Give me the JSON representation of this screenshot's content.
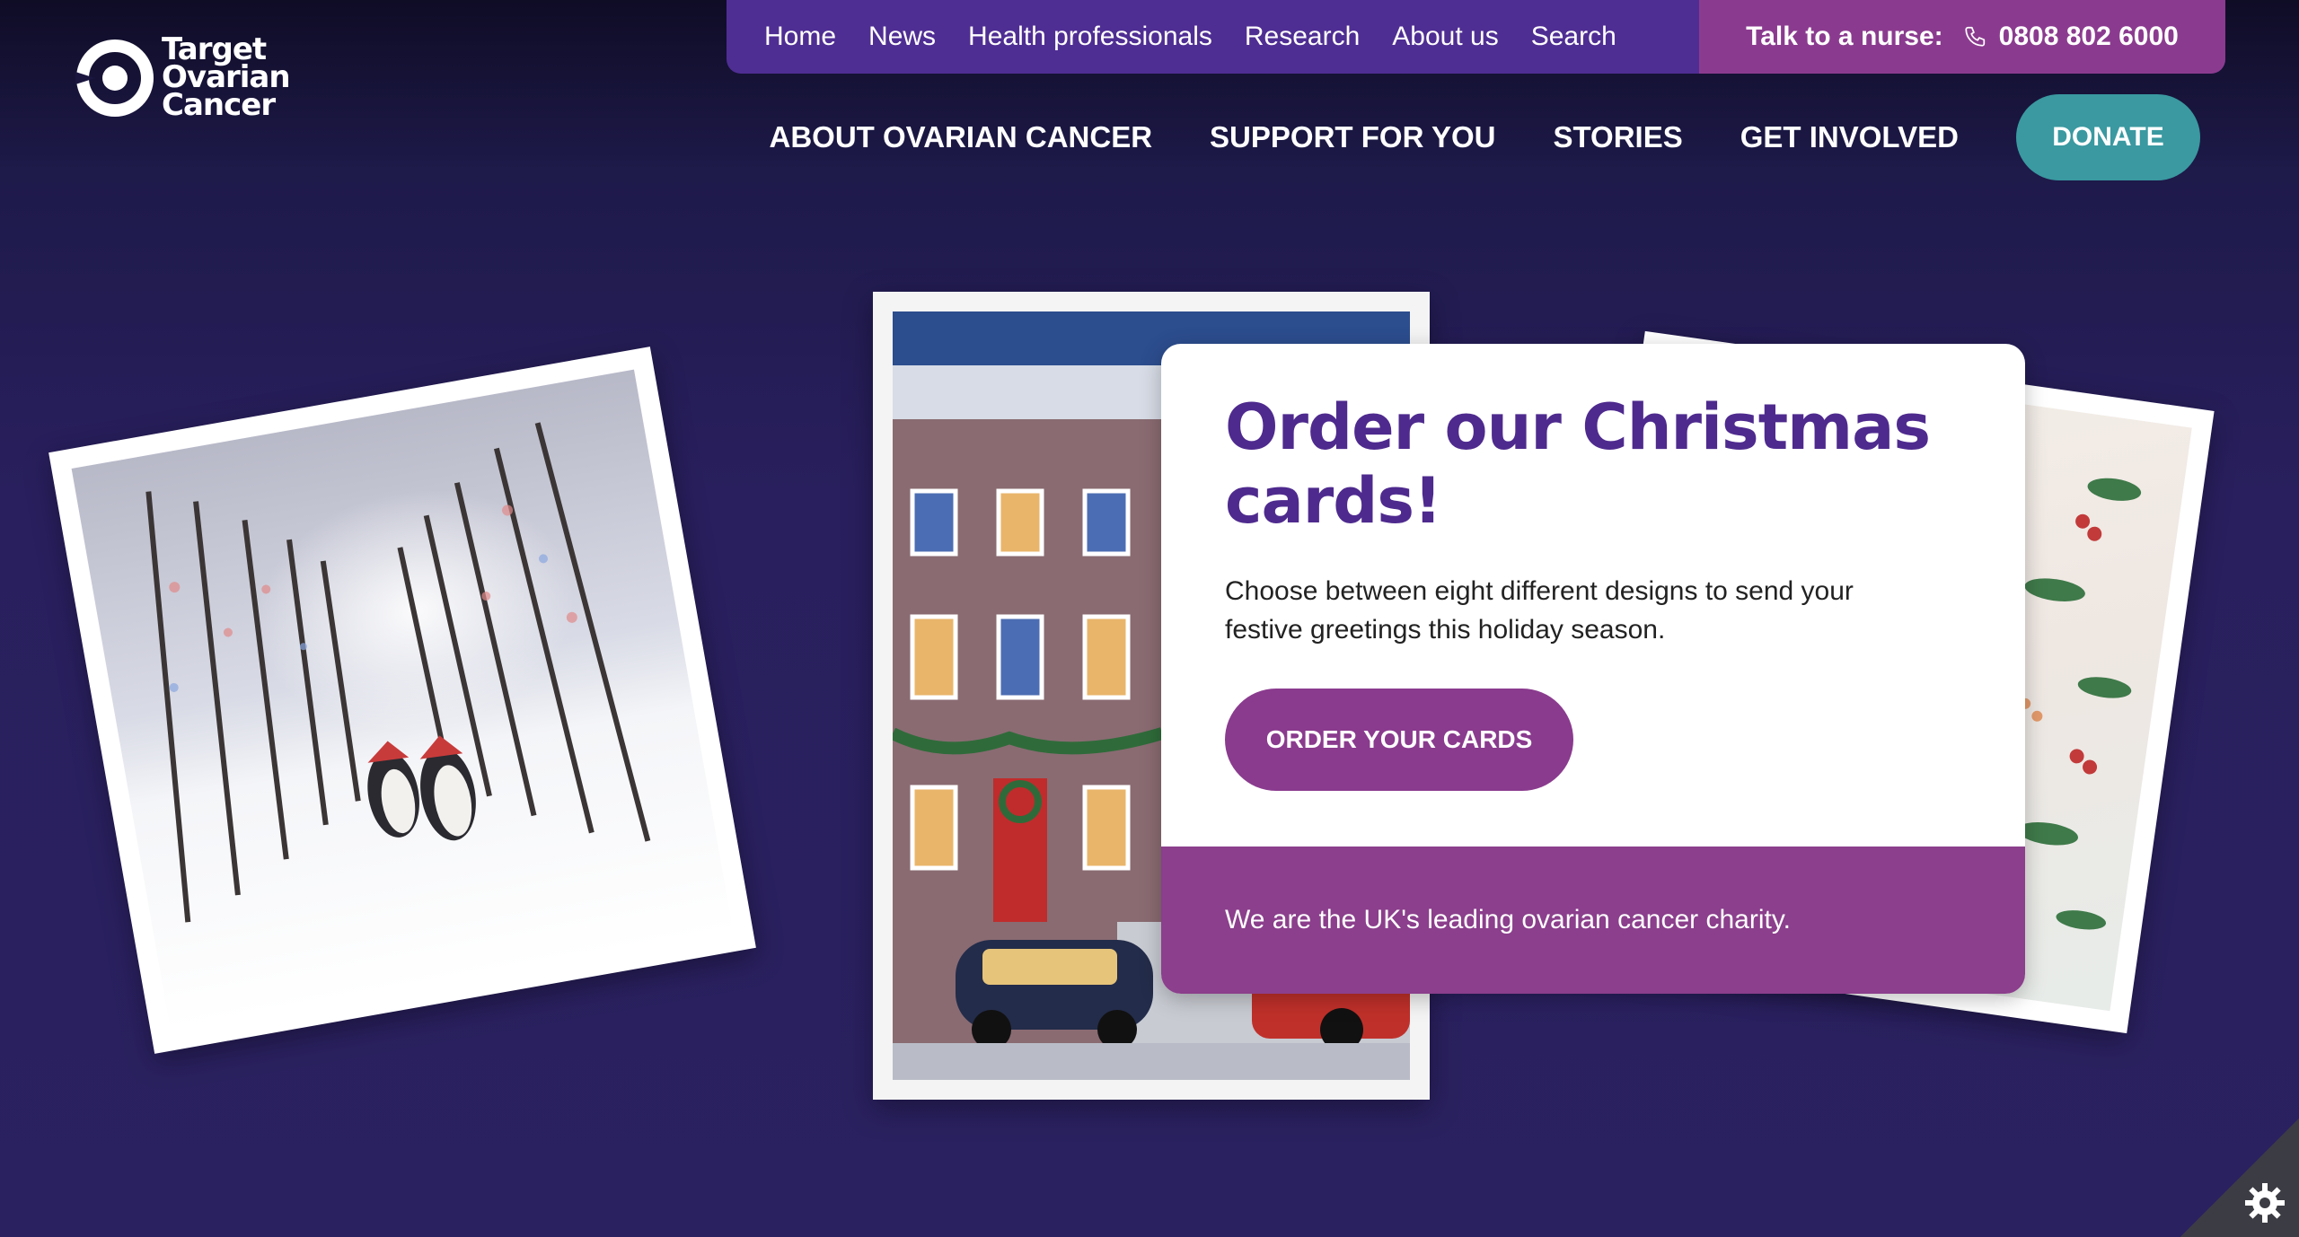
{
  "logo": {
    "lines": [
      "Target",
      "Ovarian",
      "Cancer"
    ]
  },
  "topbar": {
    "links": [
      "Home",
      "News",
      "Health professionals",
      "Research",
      "About us",
      "Search"
    ],
    "nurse_label": "Talk to a nurse:",
    "nurse_phone": "0808 802 6000"
  },
  "mainnav": {
    "links": [
      "ABOUT OVARIAN CANCER",
      "SUPPORT FOR YOU",
      "STORIES",
      "GET INVOLVED"
    ],
    "donate_label": "DONATE"
  },
  "promo": {
    "title": "Order our Christmas cards!",
    "description": "Choose between eight different designs to send your festive greetings this holiday season.",
    "button_label": "ORDER YOUR CARDS",
    "footer_text": "We are the UK's leading ovarian cancer charity."
  },
  "icons": [
    "logo-ring-icon",
    "phone-icon",
    "cookie-settings-icon"
  ],
  "colors": {
    "background": "#291f5e",
    "topbar": "#4f2e93",
    "nurse": "#8b3b8f",
    "donate": "#3a99a1",
    "title": "#4e2a8e",
    "button": "#8a3b8e"
  }
}
